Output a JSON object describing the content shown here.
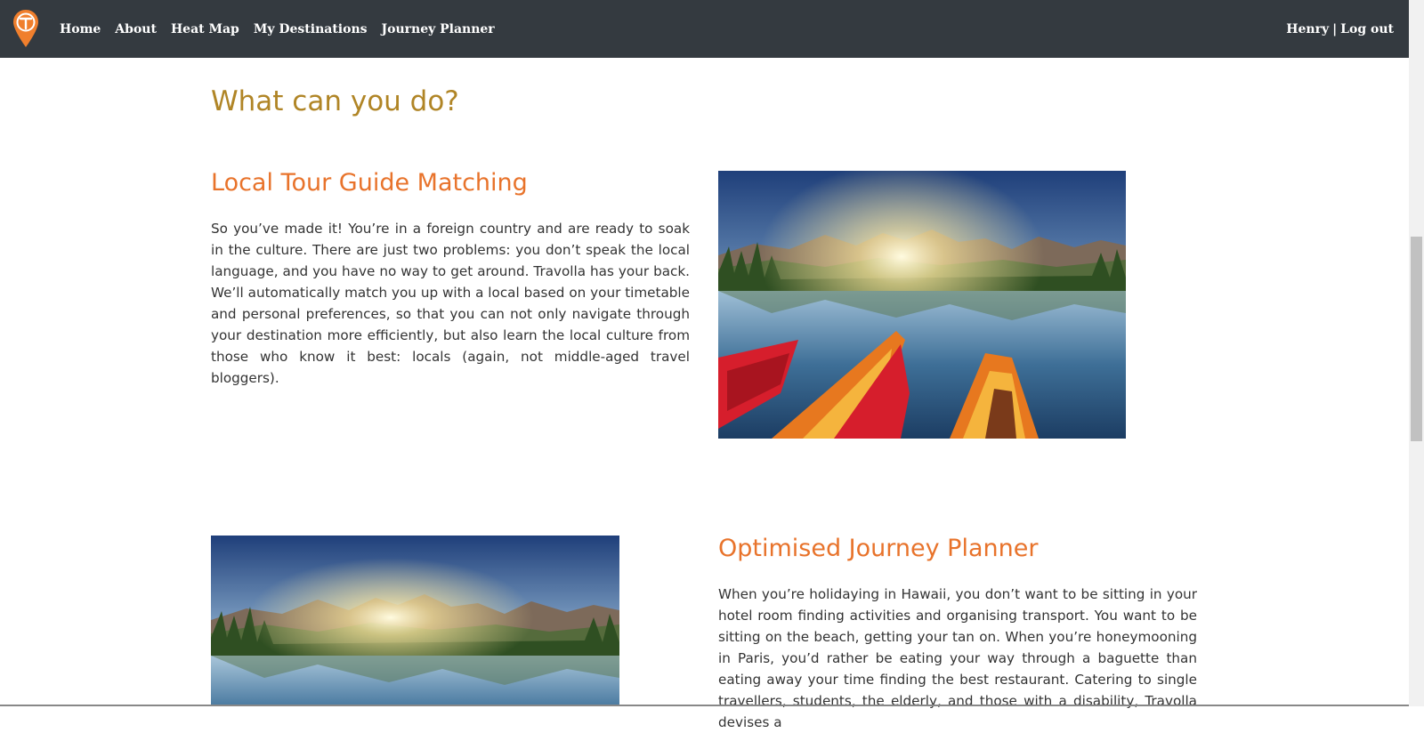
{
  "nav": {
    "items": [
      {
        "label": "Home"
      },
      {
        "label": "About"
      },
      {
        "label": "Heat Map"
      },
      {
        "label": "My Destinations"
      },
      {
        "label": "Journey Planner"
      }
    ],
    "user_name": "Henry",
    "separator": "|",
    "logout_label": "Log out"
  },
  "main": {
    "heading": "What can you do?",
    "sections": [
      {
        "title": "Local Tour Guide Matching",
        "text": "So you’ve made it! You’re in a foreign country and are ready to soak in the culture. There are just two problems: you don’t speak the local language, and you have no way to get around. Travolla has your back. We’ll automatically match you up with a local based on your timetable and personal preferences, so that you can not only navigate through your destination more efficiently, but also learn the local culture from those who know it best: locals (again, not middle-aged travel bloggers)."
      },
      {
        "title": "Optimised Journey Planner",
        "text": "When you’re holidaying in Hawaii, you don’t want to be sitting in your hotel room finding activities and organising transport. You want to be sitting on the beach, getting your tan on. When you’re honeymooning in Paris, you’d rather be eating your way through a baguette than eating away your time finding the best restaurant. Catering to single travellers, students, the elderly, and those with a disability, Travolla devises a"
      }
    ]
  },
  "colors": {
    "navbar": "#343a40",
    "heading": "#b08526",
    "section_title": "#e8732b",
    "logo": "#f07f2d"
  },
  "icons": {
    "logo": "map-pin-logo-icon"
  }
}
